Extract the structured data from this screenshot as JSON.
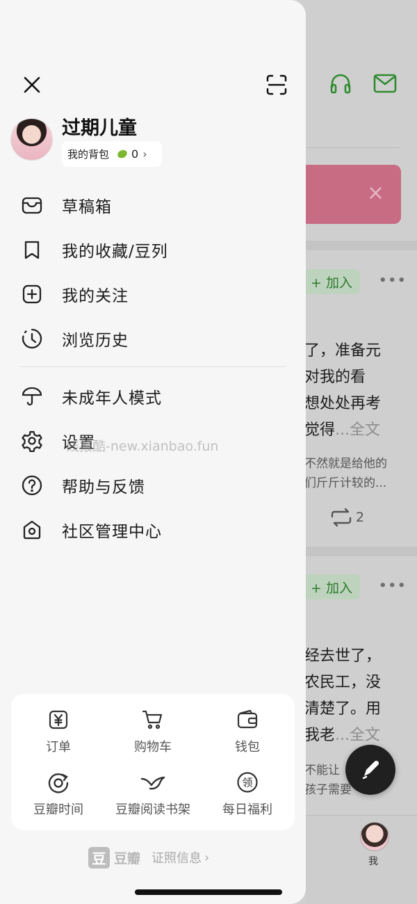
{
  "drawer": {
    "username": "过期儿童",
    "bag": {
      "label": "我的背包",
      "count": "0"
    },
    "menu": [
      {
        "label": "草稿箱",
        "icon": "inbox-icon"
      },
      {
        "label": "我的收藏/豆列",
        "icon": "bookmark-icon"
      },
      {
        "label": "我的关注",
        "icon": "plus-square-icon"
      },
      {
        "label": "浏览历史",
        "icon": "clock-icon"
      },
      {
        "label": "未成年人模式",
        "icon": "umbrella-icon"
      },
      {
        "label": "设置",
        "icon": "gear-icon"
      },
      {
        "label": "帮助与反馈",
        "icon": "question-icon"
      },
      {
        "label": "社区管理中心",
        "icon": "shield-home-icon"
      }
    ],
    "watermark": "线报酷-new.xianbao.fun",
    "services": [
      {
        "label": "订单",
        "icon": "yen-icon"
      },
      {
        "label": "购物车",
        "icon": "cart-icon"
      },
      {
        "label": "钱包",
        "icon": "wallet-icon"
      },
      {
        "label": "豆瓣时间",
        "icon": "douban-time-icon"
      },
      {
        "label": "豆瓣阅读书架",
        "icon": "bird-icon"
      },
      {
        "label": "每日福利",
        "icon": "gift-badge-icon"
      }
    ],
    "footer": {
      "logo_char": "豆",
      "logo_text": "豆瓣",
      "license": "证照信息"
    }
  },
  "background": {
    "join_label": "+ 加入",
    "post1": {
      "lines": [
        "了，准备元",
        "对我的看",
        "想处处再考",
        "觉得"
      ],
      "more": "...全文",
      "comment": [
        "不然就是给他的",
        "们斤斤计较的..."
      ],
      "reposts": "2"
    },
    "post2": {
      "lines": [
        "经去世了，",
        "农民工，没",
        "清楚了。用",
        "我老"
      ],
      "more": "...全文",
      "comment": [
        "不能让",
        "孩子需要"
      ]
    },
    "tab_me": "我"
  },
  "colors": {
    "accent": "#2f8a2f",
    "banner": "#c76c83",
    "drawer_bg": "#f6f6f6"
  }
}
